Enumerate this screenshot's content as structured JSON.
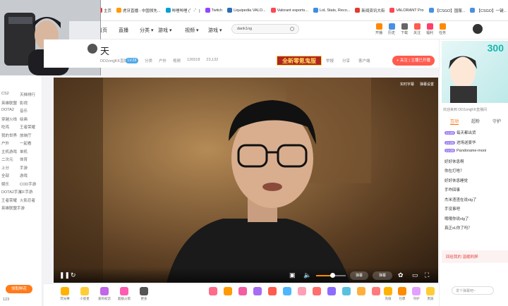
{
  "bookmarks": [
    {
      "label": "主页",
      "color": "#e23a2e"
    },
    {
      "label": "虎牙直播 - 中国领先...",
      "color": "#ff9a00"
    },
    {
      "label": "哔哩哔哩 (゜-゜)",
      "color": "#00a1d6"
    },
    {
      "label": "Twitch",
      "color": "#9146ff"
    },
    {
      "label": "Liquipedia VALO...",
      "color": "#2a6eb5"
    },
    {
      "label": "Valorant esports...",
      "color": "#ff4655"
    },
    {
      "label": "LoL Stats, Reco...",
      "color": "#3a8ee6"
    },
    {
      "label": "新闻资讯大街",
      "color": "#e23a2e"
    },
    {
      "label": "VALORANT Pro",
      "color": "#ff4655"
    },
    {
      "label": "【CSGO】国服...",
      "color": "#4a90e2"
    },
    {
      "label": "【CSGO】一键...",
      "color": "#4a90e2"
    }
  ],
  "bookmark_folder": "其他书签",
  "nav": {
    "links": [
      "首页",
      "直播",
      "分类 ▾",
      "游戏 ▾",
      "视频 ▾",
      "游戏 ▾"
    ],
    "search_value": "dank1ng",
    "icons": [
      "开播",
      "历史",
      "下载",
      "关注",
      "福利",
      "任务"
    ]
  },
  "sidebar": {
    "items": [
      "CS2",
      "天梯排行",
      "英雄联盟",
      "影视",
      "DOTA2",
      "音乐",
      "穿越火线",
      "绘画",
      "吃鸡",
      "王者荣耀",
      "我的世界",
      "放映厅",
      "户外",
      "一起看",
      "主机游戏",
      "单机",
      "二次元",
      "体育",
      "上分",
      "手游",
      "全部",
      "游戏",
      "娱乐",
      "COD手游",
      "DOTA2手游",
      "CF手游",
      "王者荣耀",
      "火影忍者",
      "英雄联盟手游"
    ],
    "fresh_button": "领取鲜花",
    "room_id": "123"
  },
  "room": {
    "title": "天",
    "streamer": "DD2zmjjKK直播间",
    "level_badge": "LV.29",
    "meta": [
      "分类",
      "户外",
      "视频",
      "126518",
      "23,132"
    ],
    "promo": "全新零氪鬼服",
    "actions": [
      "举报",
      "分享",
      "客户端"
    ],
    "follow": "+ 关注 | 主播已开播"
  },
  "video": {
    "top_buttons": [
      "实时字幕",
      "弹幕设置"
    ],
    "controls": {
      "danmaku_toggle": "弹幕",
      "input_placeholder": "弹幕",
      "volume": 0.55
    }
  },
  "gifts": [
    {
      "label": "荧光棒",
      "color": "#ffb300"
    },
    {
      "label": "小星星",
      "color": "#ffcd38"
    },
    {
      "label": "爱的初恋",
      "color": "#c068e8"
    },
    {
      "label": "超级火箭",
      "color": "#ff5bb0"
    },
    {
      "label": "更多",
      "color": "#555"
    },
    {
      "label": "",
      "color": "#ff6b8a"
    },
    {
      "label": "",
      "color": "#ff9a00"
    },
    {
      "label": "",
      "color": "#f25ea4"
    },
    {
      "label": "",
      "color": "#a66cf2"
    },
    {
      "label": "",
      "color": "#ff5b4f"
    },
    {
      "label": "",
      "color": "#4db6ff"
    },
    {
      "label": "",
      "color": "#ff9fb5"
    },
    {
      "label": "",
      "color": "#ff6e6e"
    },
    {
      "label": "",
      "color": "#8c6cff"
    },
    {
      "label": "",
      "color": "#5bc0de"
    },
    {
      "label": "",
      "color": "#ffb03b"
    },
    {
      "label": "",
      "color": "#ff7b7b"
    }
  ],
  "gift_actions": [
    "充值",
    "包裹",
    "守护",
    "贵族"
  ],
  "right": {
    "banner": "300",
    "tabs": [
      "互动",
      "超粉",
      "守护"
    ],
    "notice": "欢迎来到 DD2zmjjKK直播间",
    "messages": [
      {
        "user": "",
        "text": "每天都出货",
        "lvl": "LV.20"
      },
      {
        "user": "",
        "text": "进场送豪华",
        "lvl": "LV.25"
      },
      {
        "user": "",
        "text": "Pandorame-mooi",
        "lvl": "LV.28"
      },
      {
        "user": "",
        "text": "好好休息啊",
        "lvl": ""
      },
      {
        "user": "",
        "text": "你在打啥？",
        "lvl": ""
      },
      {
        "user": "",
        "text": "好好休息睡觉",
        "lvl": ""
      },
      {
        "user": "",
        "text": "手咋回事",
        "lvl": ""
      },
      {
        "user": "",
        "text": "杰米渣渣在说xlg了",
        "lvl": ""
      },
      {
        "user": "",
        "text": "手没事吧",
        "lvl": ""
      },
      {
        "user": "",
        "text": "哦哦你说xlg了",
        "lvl": ""
      },
      {
        "user": "",
        "text": "真正xL你了吗？",
        "lvl": ""
      }
    ],
    "bottom": "回给我的 温暖刷屏",
    "input_placeholder": "发个弹幕吧~"
  }
}
